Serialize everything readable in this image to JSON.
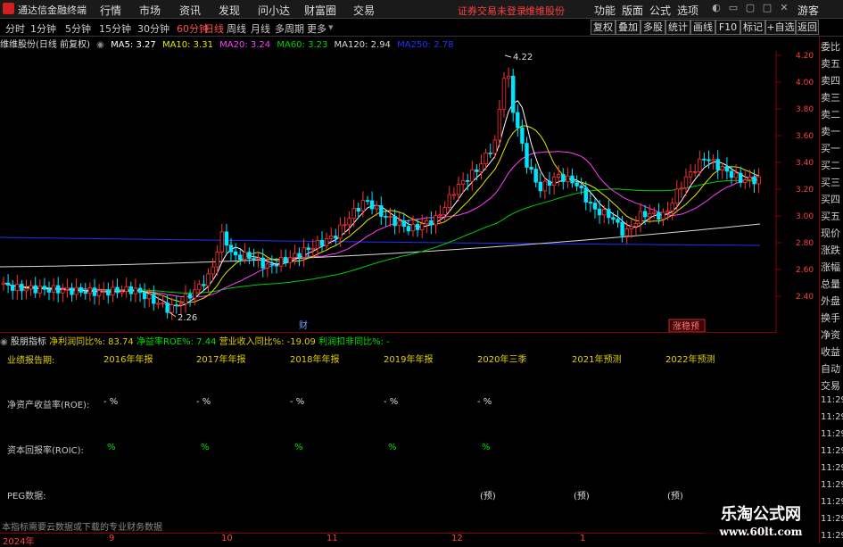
{
  "titlebar": {
    "app_name": "通达信金融终端",
    "menus": [
      "行情",
      "市场",
      "资讯",
      "发现",
      "问小达",
      "财富圈",
      "交易"
    ],
    "warning": "证券交易未登录",
    "stock_link": "维维股份",
    "right_menus": [
      "功能",
      "版面",
      "公式",
      "选项"
    ],
    "guest": "游客"
  },
  "periodbar": {
    "periods": [
      "分时",
      "1分钟",
      "5分钟",
      "15分钟",
      "30分钟",
      "60分钟",
      "日线",
      "周线",
      "月线",
      "多周期",
      "更多"
    ],
    "active": "日线",
    "tools": [
      "复权",
      "叠加",
      "多股",
      "统计",
      "画线",
      "F10",
      "标记",
      "+自选",
      "返回"
    ]
  },
  "ma_bar": {
    "name": "维维股份(日线 前复权)",
    "ma5": "MA5: 3.27",
    "ma10": "MA10: 3.31",
    "ma20": "MA20: 3.24",
    "ma60": "MA60: 3.23",
    "ma120": "MA120: 2.94",
    "ma250": "MA250: 2.78"
  },
  "colors": {
    "up": "#ff3333",
    "down": "#00e5ff",
    "ma5": "#ffffff",
    "ma10": "#e6e600",
    "ma20": "#ff40ff",
    "ma60": "#00d000",
    "ma120": "#d8d8d8",
    "ma250": "#2030ff",
    "axis": "#ff4040"
  },
  "chart": {
    "y_ticks": [
      "4.20",
      "4.00",
      "3.80",
      "3.60",
      "3.40",
      "3.20",
      "3.00",
      "2.80",
      "2.60",
      "2.40"
    ],
    "high_label": "4.22",
    "low_label": "2.26",
    "cai_marker": "财",
    "event_marker": "涨稳预"
  },
  "indicator": {
    "name": "股朋指标",
    "v1": "净利润同比%: 83.74",
    "v2": "净益率ROE%: 7.44",
    "v3": "营业收入同比%: -19.09",
    "v4": "利润扣非同比%: -",
    "period_label": "业绩报告期:",
    "periods": [
      "2016年年报",
      "2017年年报",
      "2018年年报",
      "2019年年报",
      "2020年三季",
      "2021年预测",
      "2022年预测"
    ],
    "roe_label": "净资产收益率(ROE):",
    "roe_values": [
      "- %",
      "- %",
      "- %",
      "- %",
      "- %"
    ],
    "roic_label": "资本回报率(ROIC):",
    "roic_values": [
      "%",
      "%",
      "%",
      "%",
      "%"
    ],
    "peg_label": "PEG数据:",
    "peg_values": [
      "(预)",
      "(预)",
      "(预)"
    ],
    "note": "本指标需要云数据或下载的专业财务数据"
  },
  "date_axis": [
    "2024年",
    "9",
    "10",
    "11",
    "12",
    "1"
  ],
  "side_panel": [
    "委比",
    "卖五",
    "卖四",
    "卖三",
    "卖二",
    "卖一",
    "买一",
    "买二",
    "买三",
    "买四",
    "买五",
    "现价",
    "涨跌",
    "涨幅",
    "总量",
    "外盘",
    "换手",
    "净资",
    "收益",
    "自动",
    "交易",
    "11:29",
    "11:29",
    "11:29",
    "11:29",
    "11:29",
    "11:29",
    "11:29",
    "11:29",
    "11:29"
  ],
  "watermark": {
    "title": "乐淘公式网",
    "url": "www.60lt.com"
  }
}
